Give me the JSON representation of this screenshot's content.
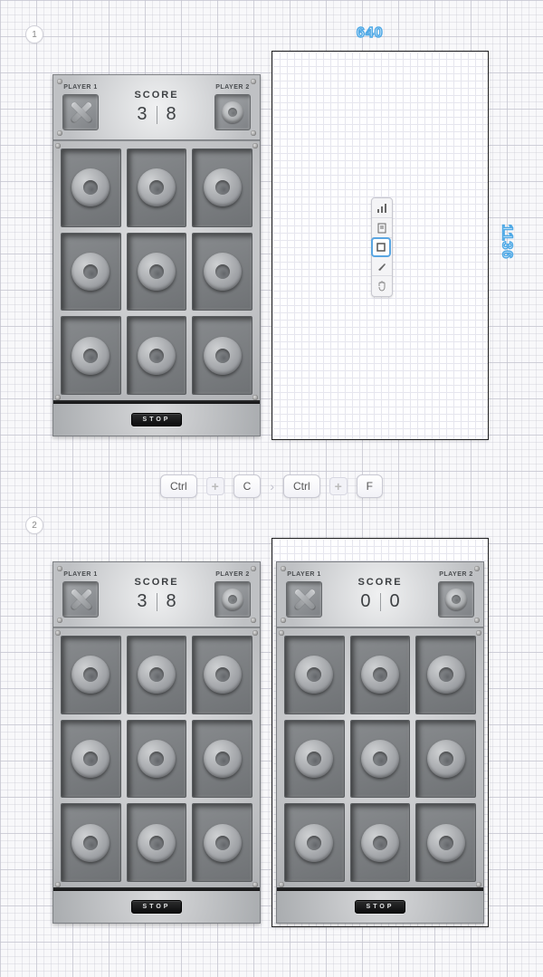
{
  "steps": {
    "one": "1",
    "two": "2"
  },
  "dimensions": {
    "width": "640",
    "height": "1136"
  },
  "toolbar_icons": {
    "chart": "chart-icon",
    "doc": "document-icon",
    "artboard": "artboard-icon",
    "knife": "knife-icon",
    "hand": "hand-icon"
  },
  "shortcut": {
    "ctrl1": "Ctrl",
    "key1": "C",
    "ctrl2": "Ctrl",
    "key2": "F"
  },
  "game": {
    "player1_label": "PLAYER 1",
    "player2_label": "PLAYER 2",
    "score_label": "SCORE",
    "stop_label": "STOP"
  },
  "board_a": {
    "score1": "3",
    "score2": "8"
  },
  "board_b": {
    "score1": "3",
    "score2": "8"
  },
  "board_c": {
    "score1": "0",
    "score2": "0"
  }
}
